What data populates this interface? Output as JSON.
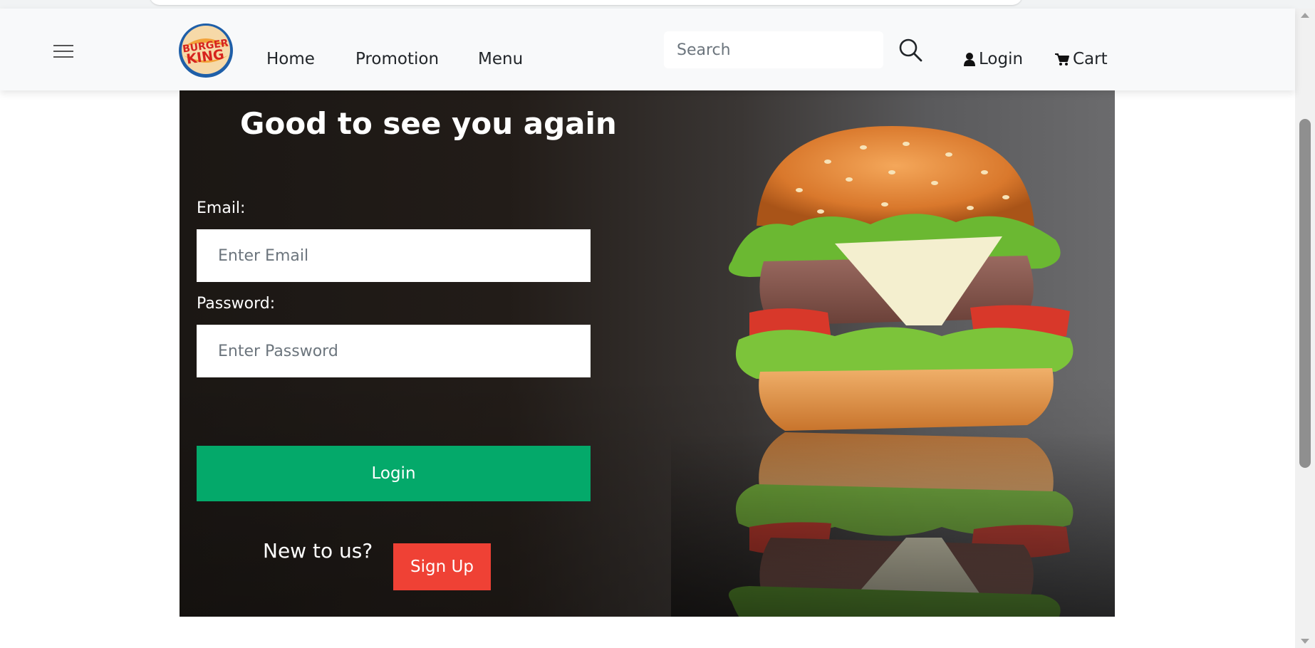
{
  "brand": {
    "logo_line1": "BURGER",
    "logo_line2": "KING"
  },
  "nav": {
    "items": [
      {
        "label": "Home"
      },
      {
        "label": "Promotion"
      },
      {
        "label": "Menu"
      }
    ],
    "search_placeholder": "Search",
    "login_label": "Login",
    "cart_label": "Cart"
  },
  "hero": {
    "title": "Good to see you again",
    "email_label": "Email:",
    "email_placeholder": "Enter Email",
    "password_label": "Password:",
    "password_placeholder": "Enter Password",
    "login_button": "Login",
    "new_text": "New to us?",
    "signup_button": "Sign Up"
  },
  "colors": {
    "accent_green": "#04a96a",
    "accent_red": "#ef4135"
  }
}
